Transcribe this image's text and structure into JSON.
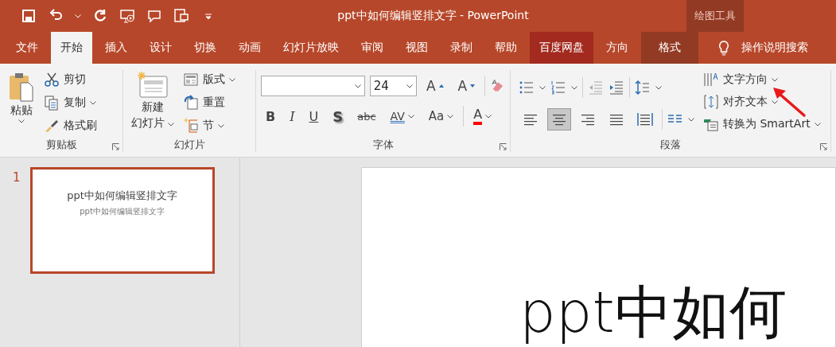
{
  "window": {
    "title": "ppt中如何编辑竖排文字  -  PowerPoint",
    "contextual_group": "绘图工具"
  },
  "tabs": [
    {
      "label": "文件",
      "kind": "normal",
      "selected": false
    },
    {
      "label": "开始",
      "kind": "normal",
      "selected": true
    },
    {
      "label": "插入",
      "kind": "normal",
      "selected": false
    },
    {
      "label": "设计",
      "kind": "normal",
      "selected": false
    },
    {
      "label": "切换",
      "kind": "normal",
      "selected": false
    },
    {
      "label": "动画",
      "kind": "normal",
      "selected": false
    },
    {
      "label": "幻灯片放映",
      "kind": "normal",
      "selected": false
    },
    {
      "label": "审阅",
      "kind": "normal",
      "selected": false
    },
    {
      "label": "视图",
      "kind": "normal",
      "selected": false
    },
    {
      "label": "录制",
      "kind": "normal",
      "selected": false
    },
    {
      "label": "帮助",
      "kind": "normal",
      "selected": false
    },
    {
      "label": "百度网盘",
      "kind": "addin",
      "selected": false
    },
    {
      "label": "方向",
      "kind": "normal",
      "selected": false
    },
    {
      "label": "格式",
      "kind": "contextual",
      "selected": false
    }
  ],
  "tell_me": "操作说明搜索",
  "clipboard": {
    "label": "剪贴板",
    "paste": "粘贴",
    "cut": "剪切",
    "copy": "复制",
    "format_painter": "格式刷"
  },
  "slides": {
    "label": "幻灯片",
    "new_slide": [
      "新建",
      "幻灯片"
    ],
    "layout": "版式",
    "reset": "重置",
    "section": "节"
  },
  "font": {
    "label": "字体",
    "font_size": "24",
    "size_buttons": [
      {
        "label": "A",
        "kind": "grow"
      },
      {
        "label": "A",
        "kind": "shrink"
      }
    ],
    "format_buttons": [
      {
        "label": "B",
        "kind": "bold"
      },
      {
        "label": "I",
        "kind": "italic"
      },
      {
        "label": "U",
        "kind": "underline"
      },
      {
        "label": "S",
        "kind": "shadow"
      },
      {
        "label": "abc",
        "kind": "strike"
      },
      {
        "label": "AV",
        "kind": "spacing"
      },
      {
        "label": "Aa",
        "kind": "case"
      }
    ],
    "font_color": "A"
  },
  "paragraph": {
    "label": "段落",
    "text_direction": "文字方向",
    "align_text": "对齐文本",
    "smartart": "转换为 SmartArt",
    "alignment": [
      {
        "kind": "left",
        "selected": false
      },
      {
        "kind": "center",
        "selected": true
      },
      {
        "kind": "right",
        "selected": false
      },
      {
        "kind": "justify",
        "selected": false
      },
      {
        "kind": "distribute",
        "selected": false
      }
    ]
  },
  "thumbnails": [
    {
      "number": "1",
      "title": "ppt中如何编辑竖排文字",
      "subtitle": "ppt中如何编辑竖排文字",
      "selected": true
    }
  ],
  "slide": {
    "title": "ppt中如何"
  }
}
